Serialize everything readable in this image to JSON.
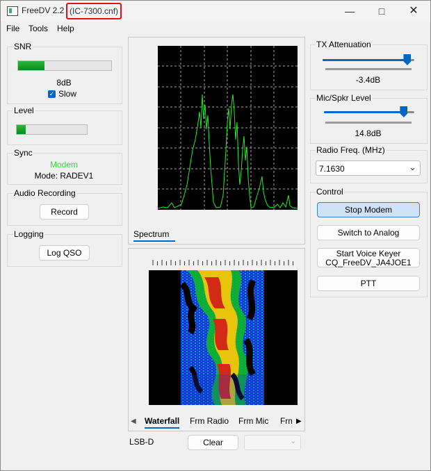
{
  "window": {
    "title": "FreeDV 2.2",
    "config": "(IC-7300.cnf)",
    "minimize_icon": "minimize-icon",
    "maximize_icon": "maximize-icon",
    "close_icon": "close-icon"
  },
  "menu": [
    "File",
    "Tools",
    "Help"
  ],
  "snr": {
    "label": "SNR",
    "value_text": "8dB",
    "level": 0.28,
    "slow_label": "Slow",
    "slow_checked": true
  },
  "level": {
    "label": "Level",
    "level": 0.13
  },
  "sync": {
    "label": "Sync",
    "status": "Modem",
    "status_color": "#33dd33",
    "mode": "Mode: RADEV1"
  },
  "audio_recording": {
    "label": "Audio Recording",
    "button": "Record"
  },
  "logging": {
    "label": "Logging",
    "button": "Log QSO"
  },
  "spectrum": {
    "tab": "Spectrum",
    "line_color": "#22ee22",
    "bg": "#000000"
  },
  "waterfall": {
    "tabs": [
      "Waterfall",
      "Frm Radio",
      "Frm Mic",
      "Frm"
    ],
    "active_tab": "Waterfall",
    "left_arrow": "scroll-left-icon",
    "right_arrow": "scroll-right-icon"
  },
  "bottom": {
    "mode_label": "LSB-D",
    "clear_button": "Clear"
  },
  "tx_attenuation": {
    "label": "TX Attenuation",
    "value_text": "-3.4dB",
    "level": 0.92
  },
  "mic_level": {
    "label": "Mic/Spkr Level",
    "value_text": "14.8dB",
    "level": 0.88
  },
  "radio_freq": {
    "label": "Radio Freq. (MHz)",
    "value": "7.1630"
  },
  "control": {
    "label": "Control",
    "stop_modem": "Stop Modem",
    "switch_analog": "Switch to Analog",
    "voice_keyer_line1": "Start Voice Keyer",
    "voice_keyer_line2": "CQ_FreeDV_JA4JOE1",
    "ptt": "PTT"
  },
  "accent_color": "#0067c0"
}
